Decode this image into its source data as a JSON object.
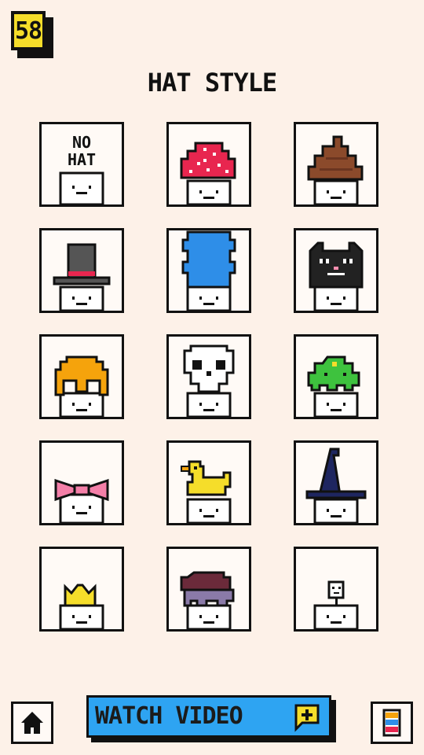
{
  "hud": {
    "coins": "58"
  },
  "title": "HAT STYLE",
  "hats": [
    {
      "name": "NO HAT",
      "label": "NO HAT"
    },
    {
      "name": "mushroom"
    },
    {
      "name": "poop"
    },
    {
      "name": "top hat"
    },
    {
      "name": "blue tube"
    },
    {
      "name": "black cat"
    },
    {
      "name": "orange hair"
    },
    {
      "name": "skull"
    },
    {
      "name": "green slime"
    },
    {
      "name": "pink bow"
    },
    {
      "name": "yellow duck"
    },
    {
      "name": "wizard hat"
    },
    {
      "name": "crown"
    },
    {
      "name": "beanie"
    },
    {
      "name": "mini box"
    }
  ],
  "footer": {
    "watch_label": "WATCH VIDEO",
    "home": "home-icon",
    "menu": "menu-icon"
  },
  "colors": {
    "background": "#fdf1e8",
    "watch_button": "#2ea4f2",
    "coin": "#f5dd2a"
  }
}
